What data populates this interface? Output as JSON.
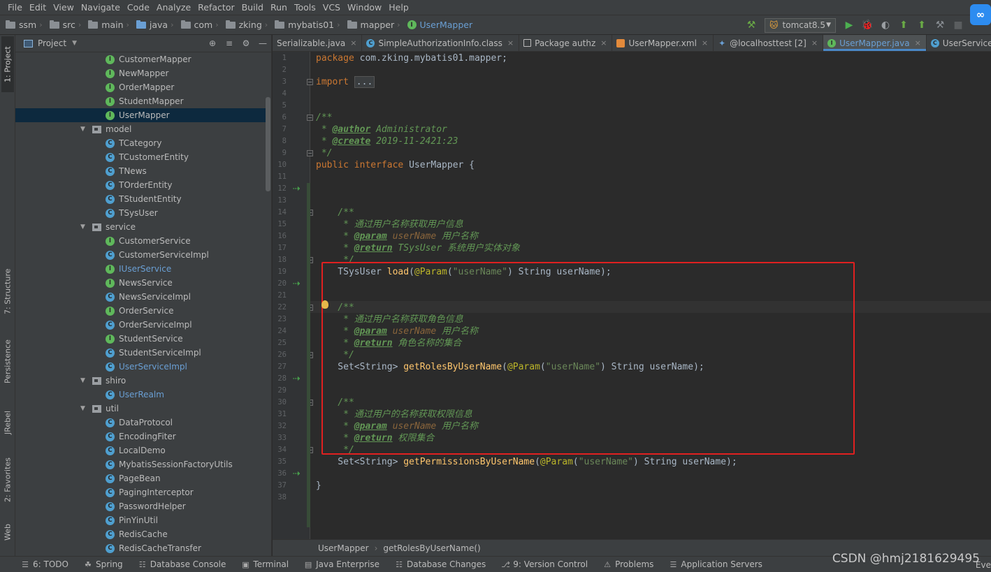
{
  "menu": [
    "File",
    "Edit",
    "View",
    "Navigate",
    "Code",
    "Analyze",
    "Refactor",
    "Build",
    "Run",
    "Tools",
    "VCS",
    "Window",
    "Help"
  ],
  "breadcrumb": [
    "ssm",
    "src",
    "main",
    "java",
    "com",
    "zking",
    "mybatis01",
    "mapper",
    "UserMapper"
  ],
  "run_config": "tomcat8.5",
  "left_tabs": [
    "1: Project",
    "7: Structure",
    "Persistence",
    "JRebel",
    "2: Favorites",
    "Web"
  ],
  "project_panel": {
    "title": "Project",
    "tree": [
      {
        "kind": "I",
        "label": "CustomerMapper",
        "indent": 2
      },
      {
        "kind": "I",
        "label": "NewMapper",
        "indent": 2
      },
      {
        "kind": "I",
        "label": "OrderMapper",
        "indent": 2
      },
      {
        "kind": "I",
        "label": "StudentMapper",
        "indent": 2
      },
      {
        "kind": "I",
        "label": "UserMapper",
        "indent": 2,
        "selected": true
      },
      {
        "kind": "pkg",
        "label": "model",
        "indent": 1
      },
      {
        "kind": "C",
        "label": "TCategory",
        "indent": 2
      },
      {
        "kind": "C",
        "label": "TCustomerEntity",
        "indent": 2
      },
      {
        "kind": "C",
        "label": "TNews",
        "indent": 2
      },
      {
        "kind": "C",
        "label": "TOrderEntity",
        "indent": 2
      },
      {
        "kind": "C",
        "label": "TStudentEntity",
        "indent": 2
      },
      {
        "kind": "C",
        "label": "TSysUser",
        "indent": 2
      },
      {
        "kind": "pkg",
        "label": "service",
        "indent": 1
      },
      {
        "kind": "I",
        "label": "CustomerService",
        "indent": 2
      },
      {
        "kind": "C",
        "label": "CustomerServiceImpl",
        "indent": 2
      },
      {
        "kind": "I",
        "label": "IUserService",
        "indent": 2,
        "blue": true
      },
      {
        "kind": "I",
        "label": "NewsService",
        "indent": 2
      },
      {
        "kind": "C",
        "label": "NewsServiceImpl",
        "indent": 2
      },
      {
        "kind": "I",
        "label": "OrderService",
        "indent": 2
      },
      {
        "kind": "C",
        "label": "OrderServiceImpl",
        "indent": 2
      },
      {
        "kind": "I",
        "label": "StudentService",
        "indent": 2
      },
      {
        "kind": "C",
        "label": "StudentServiceImpl",
        "indent": 2
      },
      {
        "kind": "C",
        "label": "UserServiceImpl",
        "indent": 2,
        "blue": true
      },
      {
        "kind": "pkg",
        "label": "shiro",
        "indent": 1
      },
      {
        "kind": "C",
        "label": "UserRealm",
        "indent": 2,
        "blue": true
      },
      {
        "kind": "pkg",
        "label": "util",
        "indent": 1
      },
      {
        "kind": "C",
        "label": "DataProtocol",
        "indent": 2
      },
      {
        "kind": "C",
        "label": "EncodingFiter",
        "indent": 2
      },
      {
        "kind": "C",
        "label": "LocalDemo",
        "indent": 2
      },
      {
        "kind": "C",
        "label": "MybatisSessionFactoryUtils",
        "indent": 2
      },
      {
        "kind": "C",
        "label": "PageBean",
        "indent": 2
      },
      {
        "kind": "C",
        "label": "PagingInterceptor",
        "indent": 2
      },
      {
        "kind": "C",
        "label": "PasswordHelper",
        "indent": 2
      },
      {
        "kind": "C",
        "label": "PinYinUtil",
        "indent": 2
      },
      {
        "kind": "C",
        "label": "RedisCache",
        "indent": 2
      },
      {
        "kind": "C",
        "label": "RedisCacheTransfer",
        "indent": 2
      }
    ]
  },
  "editor_tabs": [
    {
      "label": "Serializable.java",
      "icon": "I"
    },
    {
      "label": "SimpleAuthorizationInfo.class",
      "icon": "C"
    },
    {
      "label": "Package authz",
      "icon": "pkg"
    },
    {
      "label": "UserMapper.xml",
      "icon": "xml"
    },
    {
      "label": "@localhosttest [2]",
      "icon": "db"
    },
    {
      "label": "UserMapper.java",
      "icon": "I",
      "active": true
    },
    {
      "label": "UserServiceImpl.java",
      "icon": "C"
    }
  ],
  "code_lines": [
    "package com.zking.mybatis01.mapper;",
    "",
    "import ...",
    "",
    "",
    "/**",
    " * @author Administrator",
    " * @create 2019-11-2421:23",
    " */",
    "public interface UserMapper {",
    "",
    "",
    "",
    "    /**",
    "     * 通过用户名称获取用户信息",
    "     * @param userName 用户名称",
    "     * @return TSysUser 系统用户实体对象",
    "     */",
    "    TSysUser load(@Param(\"userName\") String userName);",
    "",
    "",
    "    /**",
    "     * 通过用户名称获取角色信息",
    "     * @param userName 用户名称",
    "     * @return 角色名称的集合",
    "     */",
    "    Set<String> getRolesByUserName(@Param(\"userName\") String userName);",
    "",
    "",
    "    /**",
    "     * 通过用户的名称获取权限信息",
    "     * @param userName 用户名称",
    "     * @return 权限集合",
    "     */",
    "    Set<String> getPermissionsByUserName(@Param(\"userName\") String userName);",
    "",
    "}",
    ""
  ],
  "editor_breadcrumb": [
    "UserMapper",
    "getRolesByUserName()"
  ],
  "status_bar": [
    "6: TODO",
    "Spring",
    "Database Console",
    "Terminal",
    "Java Enterprise",
    "Database Changes",
    "9: Version Control",
    "Problems",
    "Application Servers"
  ],
  "watermark": "CSDN @hmj2181629495",
  "event_log": "Eve"
}
